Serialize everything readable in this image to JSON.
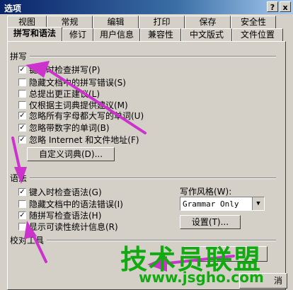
{
  "window": {
    "title": "选项",
    "help_label": "?",
    "close_label": "x"
  },
  "tabs_row1": [
    "视图",
    "常规",
    "编辑",
    "打印",
    "保存",
    "安全性"
  ],
  "tabs_row2": [
    "拼写和语法",
    "修订",
    "用户信息",
    "兼容性",
    "中文版式",
    "文件位置"
  ],
  "spelling": {
    "title": "拼写",
    "options": [
      {
        "label": "键入时检查拼写(P)",
        "checked": true
      },
      {
        "label": "隐藏文档中的拼写错误(S)",
        "checked": false
      },
      {
        "label": "总提出更正建议(L)",
        "checked": false
      },
      {
        "label": "仅根据主词典提供建议(M)",
        "checked": false
      },
      {
        "label": "忽略所有字母都大写的单词(U)",
        "checked": true
      },
      {
        "label": "忽略带数字的单词(B)",
        "checked": true
      },
      {
        "label": "忽略 Internet 和文件地址(F)",
        "checked": true
      }
    ],
    "custom_dict_button": "自定义词典(D)..."
  },
  "grammar": {
    "title": "语法",
    "options": [
      {
        "label": "键入时检查语法(G)",
        "checked": true
      },
      {
        "label": "隐藏文档中的语法错误(I)",
        "checked": false
      },
      {
        "label": "随拼写检查语法(H)",
        "checked": true
      },
      {
        "label": "显示可读性统计信息(R)",
        "checked": false
      }
    ],
    "style_label": "写作风格(W):",
    "style_value": "Grammar Only",
    "settings_button": "设置(T)..."
  },
  "proofing": {
    "title": "校对工具"
  },
  "bottom": {
    "close_button": "消"
  },
  "watermark": {
    "text": "技术员联盟",
    "url": "www.jsgho.com"
  },
  "colors": {
    "dialog_bg": "#d4d0c8",
    "titlebar": "#0a246a",
    "arrow": "#cc33cc",
    "watermark": "#11aa11"
  }
}
